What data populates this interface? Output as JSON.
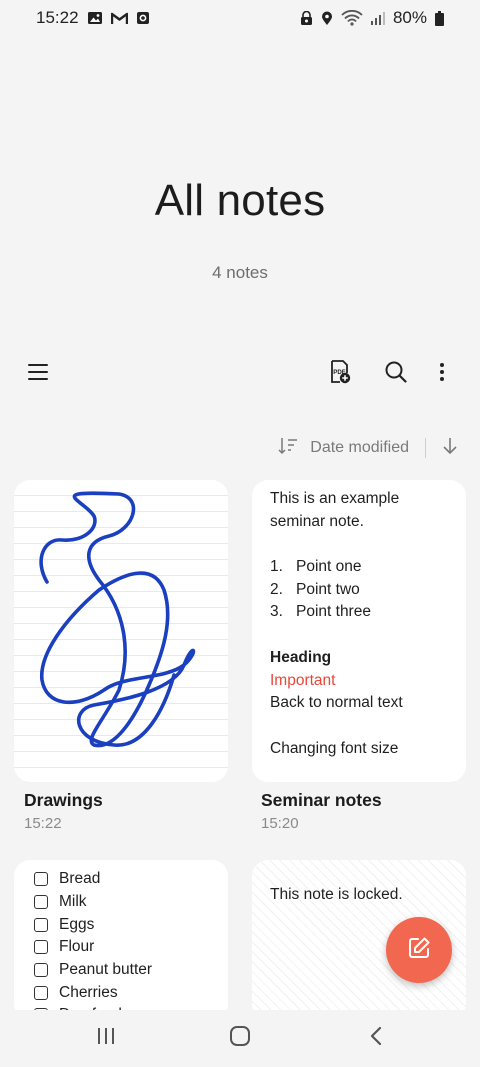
{
  "status_bar": {
    "time": "15:22",
    "battery": "80%",
    "left_icons": [
      "gallery-icon",
      "gmail-icon",
      "screenshot-icon"
    ],
    "right_icons": [
      "secure-folder-icon",
      "location-icon",
      "wifi-icon",
      "signal-icon",
      "battery-icon"
    ]
  },
  "header": {
    "title": "All notes",
    "note_count": "4 notes"
  },
  "toolbar": {
    "icons": [
      "menu-icon",
      "pdf-import-icon",
      "search-icon",
      "more-options-icon"
    ]
  },
  "sort": {
    "label": "Date modified",
    "direction": "descending"
  },
  "notes": [
    {
      "type": "drawing",
      "title": "Drawings",
      "time": "15:22",
      "stroke_color": "#1a3fbf"
    },
    {
      "type": "text",
      "title": "Seminar notes",
      "time": "15:20",
      "lines": {
        "intro1": "This is an example",
        "intro2": "seminar note.",
        "item1_num": "1.",
        "item1": "Point one",
        "item2_num": "2.",
        "item2": "Point two",
        "item3_num": "3.",
        "item3": "Point three",
        "heading": "Heading",
        "important": "Important",
        "normal": "Back to normal text",
        "font_size": "Changing font size"
      }
    },
    {
      "type": "checklist",
      "items": [
        "Bread",
        "Milk",
        "Eggs",
        "Flour",
        "Peanut butter",
        "Cherries",
        "Dog food"
      ]
    },
    {
      "type": "locked",
      "text": "This note is locked."
    }
  ],
  "fab": {
    "icon": "compose-icon",
    "color": "#f2674f"
  },
  "nav_bar": {
    "icons": [
      "recent-apps-icon",
      "home-icon",
      "back-icon"
    ]
  },
  "colors": {
    "accent": "#f2674f",
    "important_text": "#e8473a",
    "background": "#f4f4f4"
  }
}
